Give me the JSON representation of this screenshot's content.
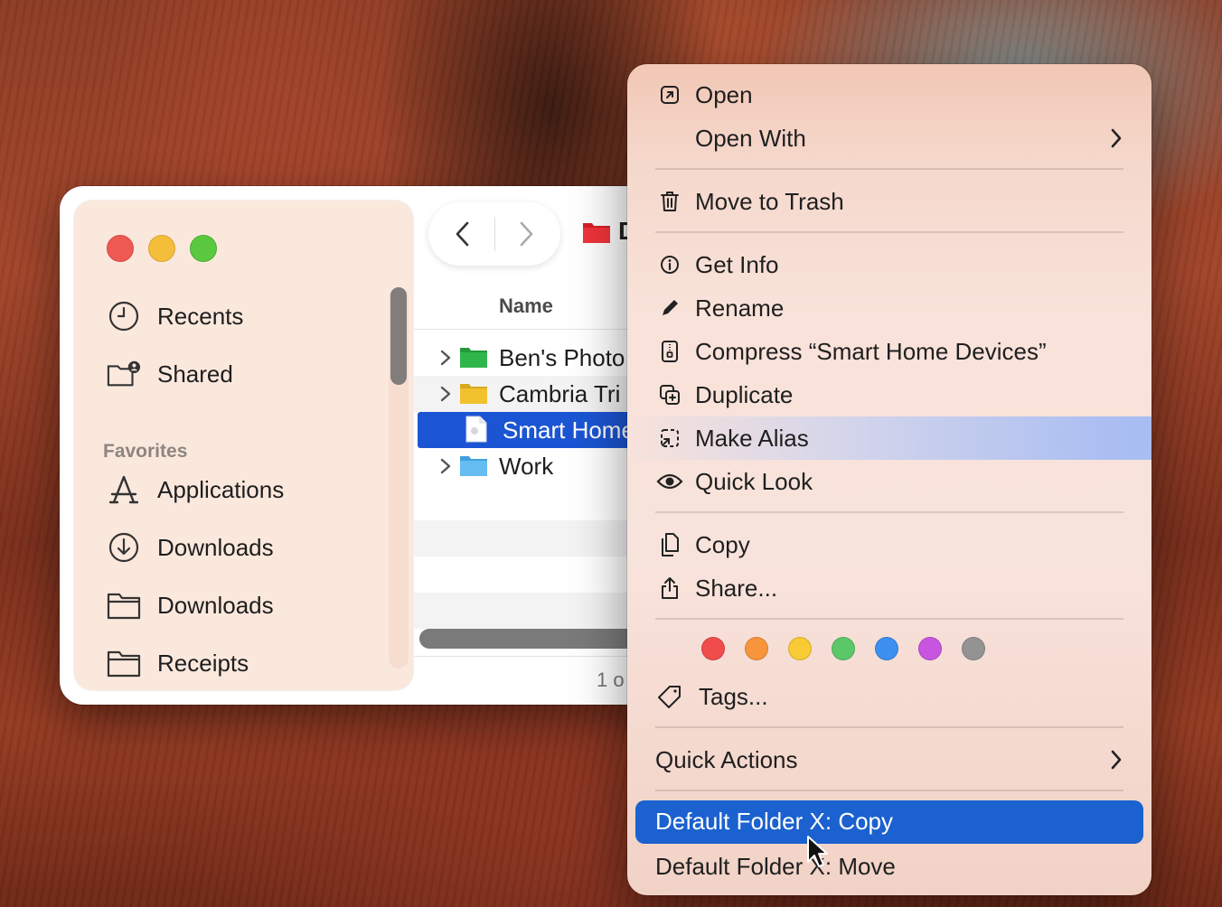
{
  "finder": {
    "sidebar": {
      "items_top": [
        {
          "label": "Recents",
          "icon": "clock-icon"
        },
        {
          "label": "Shared",
          "icon": "shared-folder-icon"
        }
      ],
      "section_header": "Favorites",
      "favorites": [
        {
          "label": "Applications",
          "icon": "applications-icon"
        },
        {
          "label": "Downloads",
          "icon": "download-icon"
        },
        {
          "label": "Downloads",
          "icon": "folder-icon"
        },
        {
          "label": "Receipts",
          "icon": "folder-icon"
        }
      ]
    },
    "toolbar": {
      "title_partial": "D"
    },
    "column_header": "Name",
    "rows": [
      {
        "name": "Ben's Photo",
        "folder_color": "#2fb64a",
        "expandable": true
      },
      {
        "name": "Cambria Tri",
        "folder_color": "#f2c12e",
        "expandable": true
      },
      {
        "name": "Smart Home",
        "selected": true,
        "expandable": false
      },
      {
        "name": "Work",
        "folder_color": "#56b4ef",
        "expandable": true
      }
    ],
    "status": "1 o"
  },
  "context_menu": {
    "open": "Open",
    "open_with": "Open With",
    "move_to_trash": "Move to Trash",
    "get_info": "Get Info",
    "rename": "Rename",
    "compress": "Compress “Smart Home Devices”",
    "duplicate": "Duplicate",
    "make_alias": "Make Alias",
    "quick_look": "Quick Look",
    "copy": "Copy",
    "share": "Share...",
    "tag_colors": [
      "#f04c4c",
      "#f6953c",
      "#f8cb34",
      "#5cc768",
      "#3d8ff0",
      "#c855e0",
      "#939393"
    ],
    "tags": "Tags...",
    "quick_actions": "Quick Actions",
    "dfx_copy": "Default Folder X: Copy",
    "dfx_move": "Default Folder X: Move"
  }
}
